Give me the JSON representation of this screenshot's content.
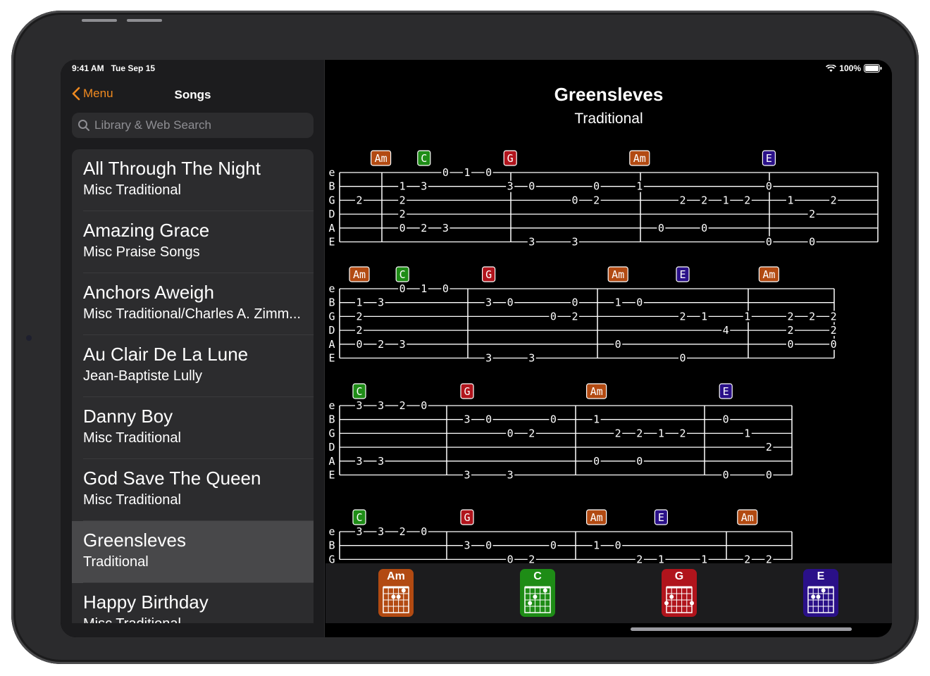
{
  "status": {
    "time": "9:41 AM",
    "date": "Tue Sep 15",
    "battery": "100%"
  },
  "sidebar": {
    "back_label": "Menu",
    "title": "Songs",
    "search_placeholder": "Library & Web Search",
    "items": [
      {
        "title": "All Through The Night",
        "subtitle": "Misc Traditional"
      },
      {
        "title": "Amazing Grace",
        "subtitle": "Misc Praise Songs"
      },
      {
        "title": "Anchors Aweigh",
        "subtitle": "Misc Traditional/Charles A. Zimm..."
      },
      {
        "title": "Au Clair De La Lune",
        "subtitle": "Jean-Baptiste Lully"
      },
      {
        "title": "Danny Boy",
        "subtitle": "Misc Traditional"
      },
      {
        "title": "God Save The Queen",
        "subtitle": "Misc Traditional"
      },
      {
        "title": "Greensleves",
        "subtitle": "Traditional",
        "selected": true
      },
      {
        "title": "Happy Birthday",
        "subtitle": "Misc Traditional"
      }
    ]
  },
  "song": {
    "title": "Greensleves",
    "artist": "Traditional"
  },
  "chord_colors": {
    "Am": "#b24a12",
    "C": "#1e8c16",
    "G": "#b0141c",
    "E": "#2a1088"
  },
  "strings": [
    "e",
    "B",
    "G",
    "D",
    "A",
    "E"
  ],
  "systems": [
    {
      "measures": 4,
      "chords": [
        {
          "name": "Am",
          "pos": 1.5
        },
        {
          "name": "C",
          "pos": 3.5
        },
        {
          "name": "G",
          "pos": 7.5
        },
        {
          "name": "Am",
          "pos": 13.5
        },
        {
          "name": "E",
          "pos": 19.5
        }
      ],
      "notes": [
        {
          "s": 0,
          "p": 4,
          "f": "0"
        },
        {
          "s": 0,
          "p": 5,
          "f": "1"
        },
        {
          "s": 0,
          "p": 6,
          "f": "0"
        },
        {
          "s": 1,
          "p": 2,
          "f": "1"
        },
        {
          "s": 1,
          "p": 3,
          "f": "3"
        },
        {
          "s": 1,
          "p": 7,
          "f": "3"
        },
        {
          "s": 1,
          "p": 8,
          "f": "0"
        },
        {
          "s": 1,
          "p": 11,
          "f": "0"
        },
        {
          "s": 1,
          "p": 13,
          "f": "1"
        },
        {
          "s": 1,
          "p": 19,
          "f": "0"
        },
        {
          "s": 2,
          "p": 0,
          "f": "2"
        },
        {
          "s": 2,
          "p": 2,
          "f": "2"
        },
        {
          "s": 2,
          "p": 10,
          "f": "0"
        },
        {
          "s": 2,
          "p": 11,
          "f": "2"
        },
        {
          "s": 2,
          "p": 15,
          "f": "2"
        },
        {
          "s": 2,
          "p": 16,
          "f": "2"
        },
        {
          "s": 2,
          "p": 17,
          "f": "1"
        },
        {
          "s": 2,
          "p": 18,
          "f": "2"
        },
        {
          "s": 2,
          "p": 20,
          "f": "1"
        },
        {
          "s": 2,
          "p": 22,
          "f": "2"
        },
        {
          "s": 3,
          "p": 2,
          "f": "2"
        },
        {
          "s": 3,
          "p": 21,
          "f": "2"
        },
        {
          "s": 4,
          "p": 2,
          "f": "0"
        },
        {
          "s": 4,
          "p": 3,
          "f": "2"
        },
        {
          "s": 4,
          "p": 4,
          "f": "3"
        },
        {
          "s": 4,
          "p": 14,
          "f": "0"
        },
        {
          "s": 4,
          "p": 16,
          "f": "0"
        },
        {
          "s": 5,
          "p": 8,
          "f": "3"
        },
        {
          "s": 5,
          "p": 10,
          "f": "3"
        },
        {
          "s": 5,
          "p": 19,
          "f": "0"
        },
        {
          "s": 5,
          "p": 21,
          "f": "0"
        }
      ]
    },
    {
      "measures": 4,
      "chords": [
        {
          "name": "Am",
          "pos": 0.5
        },
        {
          "name": "C",
          "pos": 2.5
        },
        {
          "name": "G",
          "pos": 6.5
        },
        {
          "name": "Am",
          "pos": 12.5
        },
        {
          "name": "E",
          "pos": 15.5
        },
        {
          "name": "Am",
          "pos": 19.5
        }
      ],
      "notes": [
        {
          "s": 0,
          "p": 2,
          "f": "0"
        },
        {
          "s": 0,
          "p": 3,
          "f": "1"
        },
        {
          "s": 0,
          "p": 4,
          "f": "0"
        },
        {
          "s": 1,
          "p": 0,
          "f": "1"
        },
        {
          "s": 1,
          "p": 1,
          "f": "3"
        },
        {
          "s": 1,
          "p": 6,
          "f": "3"
        },
        {
          "s": 1,
          "p": 7,
          "f": "0"
        },
        {
          "s": 1,
          "p": 10,
          "f": "0"
        },
        {
          "s": 1,
          "p": 12,
          "f": "1"
        },
        {
          "s": 1,
          "p": 13,
          "f": "0"
        },
        {
          "s": 2,
          "p": 0,
          "f": "2"
        },
        {
          "s": 2,
          "p": 9,
          "f": "0"
        },
        {
          "s": 2,
          "p": 10,
          "f": "2"
        },
        {
          "s": 2,
          "p": 15,
          "f": "2"
        },
        {
          "s": 2,
          "p": 16,
          "f": "1"
        },
        {
          "s": 2,
          "p": 18,
          "f": "1"
        },
        {
          "s": 2,
          "p": 20,
          "f": "2"
        },
        {
          "s": 2,
          "p": 21,
          "f": "2"
        },
        {
          "s": 2,
          "p": 22,
          "f": "2"
        },
        {
          "s": 3,
          "p": 0,
          "f": "2"
        },
        {
          "s": 3,
          "p": 17,
          "f": "4"
        },
        {
          "s": 3,
          "p": 20,
          "f": "2"
        },
        {
          "s": 3,
          "p": 22,
          "f": "2"
        },
        {
          "s": 4,
          "p": 0,
          "f": "0"
        },
        {
          "s": 4,
          "p": 1,
          "f": "2"
        },
        {
          "s": 4,
          "p": 2,
          "f": "3"
        },
        {
          "s": 4,
          "p": 12,
          "f": "0"
        },
        {
          "s": 4,
          "p": 20,
          "f": "0"
        },
        {
          "s": 4,
          "p": 22,
          "f": "0"
        },
        {
          "s": 5,
          "p": 6,
          "f": "3"
        },
        {
          "s": 5,
          "p": 8,
          "f": "3"
        },
        {
          "s": 5,
          "p": 15,
          "f": "0"
        }
      ]
    },
    {
      "measures": 4,
      "chords": [
        {
          "name": "C",
          "pos": 0.5
        },
        {
          "name": "G",
          "pos": 5.5
        },
        {
          "name": "Am",
          "pos": 11.5
        },
        {
          "name": "E",
          "pos": 17.5
        }
      ],
      "notes": [
        {
          "s": 0,
          "p": 0,
          "f": "3"
        },
        {
          "s": 0,
          "p": 1,
          "f": "3"
        },
        {
          "s": 0,
          "p": 2,
          "f": "2"
        },
        {
          "s": 0,
          "p": 3,
          "f": "0"
        },
        {
          "s": 1,
          "p": 5,
          "f": "3"
        },
        {
          "s": 1,
          "p": 6,
          "f": "0"
        },
        {
          "s": 1,
          "p": 9,
          "f": "0"
        },
        {
          "s": 1,
          "p": 11,
          "f": "1"
        },
        {
          "s": 1,
          "p": 17,
          "f": "0"
        },
        {
          "s": 2,
          "p": 7,
          "f": "0"
        },
        {
          "s": 2,
          "p": 8,
          "f": "2"
        },
        {
          "s": 2,
          "p": 12,
          "f": "2"
        },
        {
          "s": 2,
          "p": 13,
          "f": "2"
        },
        {
          "s": 2,
          "p": 14,
          "f": "1"
        },
        {
          "s": 2,
          "p": 15,
          "f": "2"
        },
        {
          "s": 2,
          "p": 18,
          "f": "1"
        },
        {
          "s": 3,
          "p": 19,
          "f": "2"
        },
        {
          "s": 4,
          "p": 0,
          "f": "3"
        },
        {
          "s": 4,
          "p": 1,
          "f": "3"
        },
        {
          "s": 4,
          "p": 11,
          "f": "0"
        },
        {
          "s": 4,
          "p": 13,
          "f": "0"
        },
        {
          "s": 5,
          "p": 5,
          "f": "3"
        },
        {
          "s": 5,
          "p": 7,
          "f": "3"
        },
        {
          "s": 5,
          "p": 17,
          "f": "0"
        },
        {
          "s": 5,
          "p": 19,
          "f": "0"
        }
      ]
    },
    {
      "measures": 4,
      "chords": [
        {
          "name": "C",
          "pos": 0.5
        },
        {
          "name": "G",
          "pos": 5.5
        },
        {
          "name": "Am",
          "pos": 11.5
        },
        {
          "name": "E",
          "pos": 14.5
        },
        {
          "name": "Am",
          "pos": 18.5
        }
      ],
      "notes": [
        {
          "s": 0,
          "p": 0,
          "f": "3"
        },
        {
          "s": 0,
          "p": 1,
          "f": "3"
        },
        {
          "s": 0,
          "p": 2,
          "f": "2"
        },
        {
          "s": 0,
          "p": 3,
          "f": "0"
        },
        {
          "s": 1,
          "p": 5,
          "f": "3"
        },
        {
          "s": 1,
          "p": 6,
          "f": "0"
        },
        {
          "s": 1,
          "p": 9,
          "f": "0"
        },
        {
          "s": 1,
          "p": 11,
          "f": "1"
        },
        {
          "s": 1,
          "p": 12,
          "f": "0"
        },
        {
          "s": 2,
          "p": 7,
          "f": "0"
        },
        {
          "s": 2,
          "p": 8,
          "f": "2"
        },
        {
          "s": 2,
          "p": 13,
          "f": "2"
        },
        {
          "s": 2,
          "p": 14,
          "f": "1"
        },
        {
          "s": 2,
          "p": 16,
          "f": "1"
        },
        {
          "s": 2,
          "p": 18,
          "f": "2"
        },
        {
          "s": 2,
          "p": 19,
          "f": "2"
        }
      ]
    }
  ],
  "chord_bar": [
    "Am",
    "C",
    "G",
    "E"
  ]
}
